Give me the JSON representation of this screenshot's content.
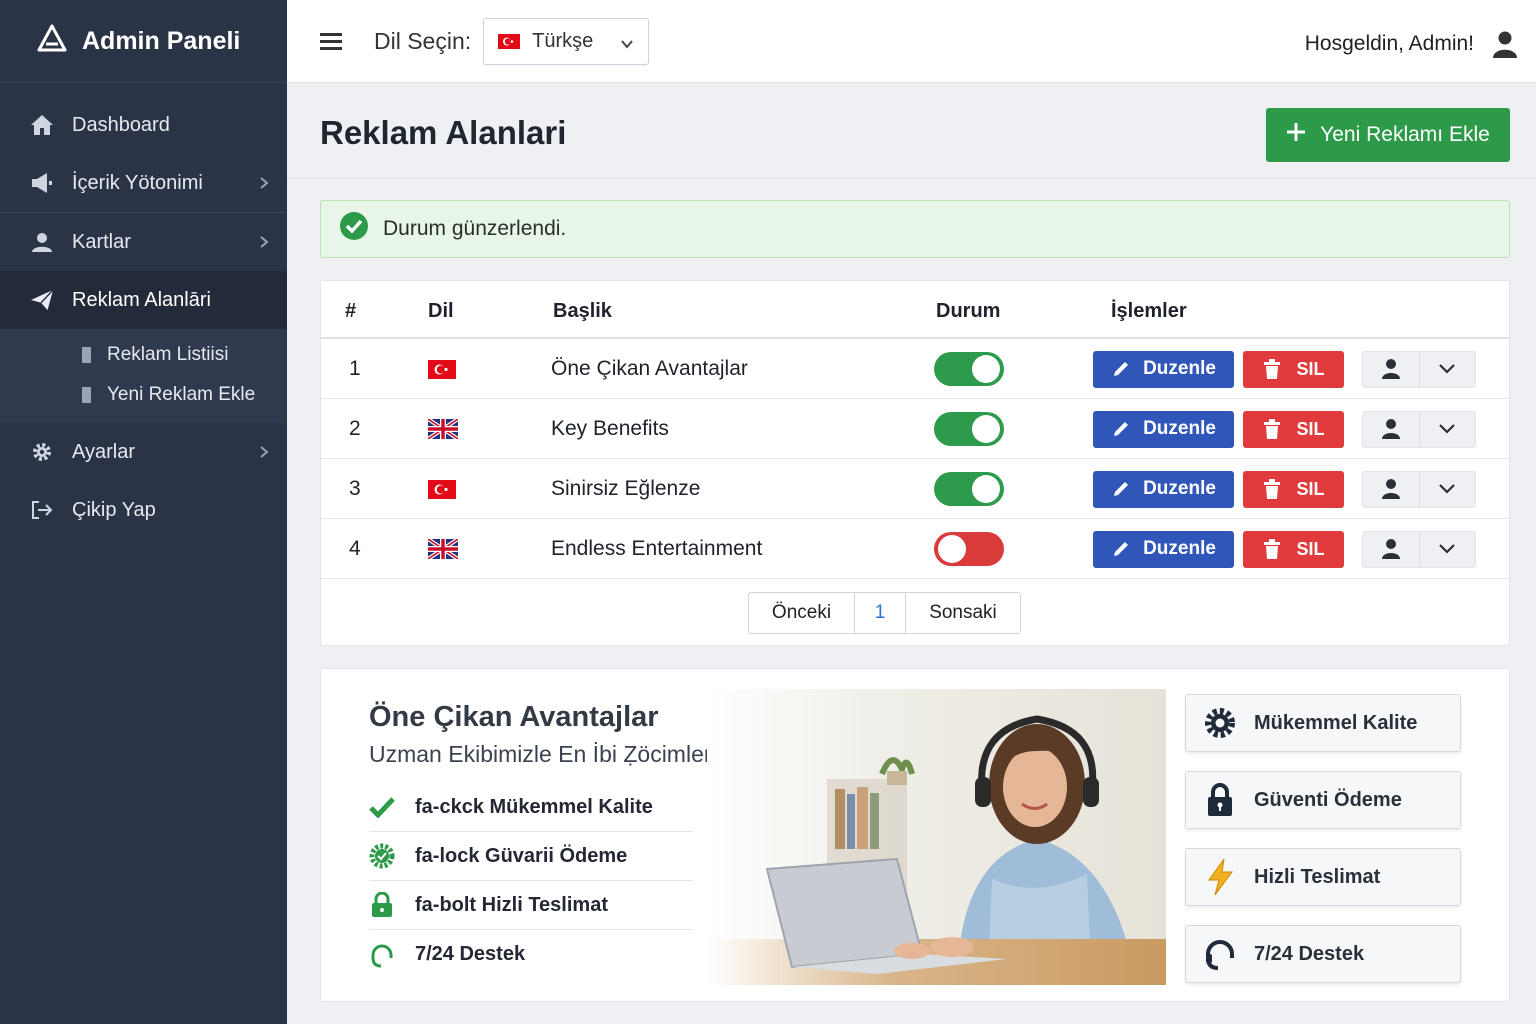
{
  "brand": {
    "title": "Admin Paneli"
  },
  "sidebar": {
    "items": [
      {
        "label": "Dashboard"
      },
      {
        "label": "İçerik Yötonimi"
      },
      {
        "label": "Kartlar"
      },
      {
        "label": "Reklam Alanlāri"
      },
      {
        "label": "Ayarlar"
      },
      {
        "label": "Çikip Yap"
      }
    ],
    "submenu": [
      {
        "label": "Reklam Listiisi"
      },
      {
        "label": "Yeni Reklam Ekle"
      }
    ]
  },
  "topbar": {
    "lang_label": "Dil Seçin:",
    "lang_value": "Türkşe",
    "welcome": "Hosgeldin, Admin!"
  },
  "page": {
    "title": "Reklam Alanlari",
    "new_button": "Yeni Reklamı Ekle",
    "alert": "Durum günzerlendi."
  },
  "table": {
    "headers": [
      "#",
      "Dil",
      "Başlik",
      "Durum",
      "İşlemler"
    ],
    "rows": [
      {
        "num": "1",
        "lang": "tr",
        "title": "Öne Çikan Avantajlar",
        "status": true
      },
      {
        "num": "2",
        "lang": "en",
        "title": "Key Benefits",
        "status": true
      },
      {
        "num": "3",
        "lang": "tr",
        "title": "Sinirsiz Eğlenze",
        "status": true
      },
      {
        "num": "4",
        "lang": "en",
        "title": "Endless Entertainment",
        "status": false
      }
    ],
    "edit_label": "Duzenle",
    "delete_label": "SIL"
  },
  "pagination": {
    "prev": "Önceki",
    "page": "1",
    "next": "Sonsaki"
  },
  "promo": {
    "title": "Öne Çikan Avantajlar",
    "subtitle": "Uzman Ekibimizle En İbi Ẓöcimler!",
    "features": [
      {
        "text": "fa-ckck Mükemmel Kalite",
        "icon": "check-icon"
      },
      {
        "text": "fa-lock Güvarii Ödeme",
        "icon": "badge-icon"
      },
      {
        "text": "fa-bolt Hizli Teslimat",
        "icon": "lock-icon"
      },
      {
        "text": "7/24 Destek",
        "icon": "headset-icon"
      }
    ],
    "cards": [
      {
        "text": "Mükemmel Kalite",
        "icon": "gear-icon"
      },
      {
        "text": "Güventi Ödeme",
        "icon": "lock-icon"
      },
      {
        "text": "Hizli Teslimat",
        "icon": "bolt-icon"
      },
      {
        "text": "7/24 Destek",
        "icon": "headset-icon"
      }
    ]
  },
  "colors": {
    "sidebar": "#2b3446",
    "success": "#2c9a48",
    "primary": "#2f56b8",
    "danger": "#e03a3c"
  }
}
